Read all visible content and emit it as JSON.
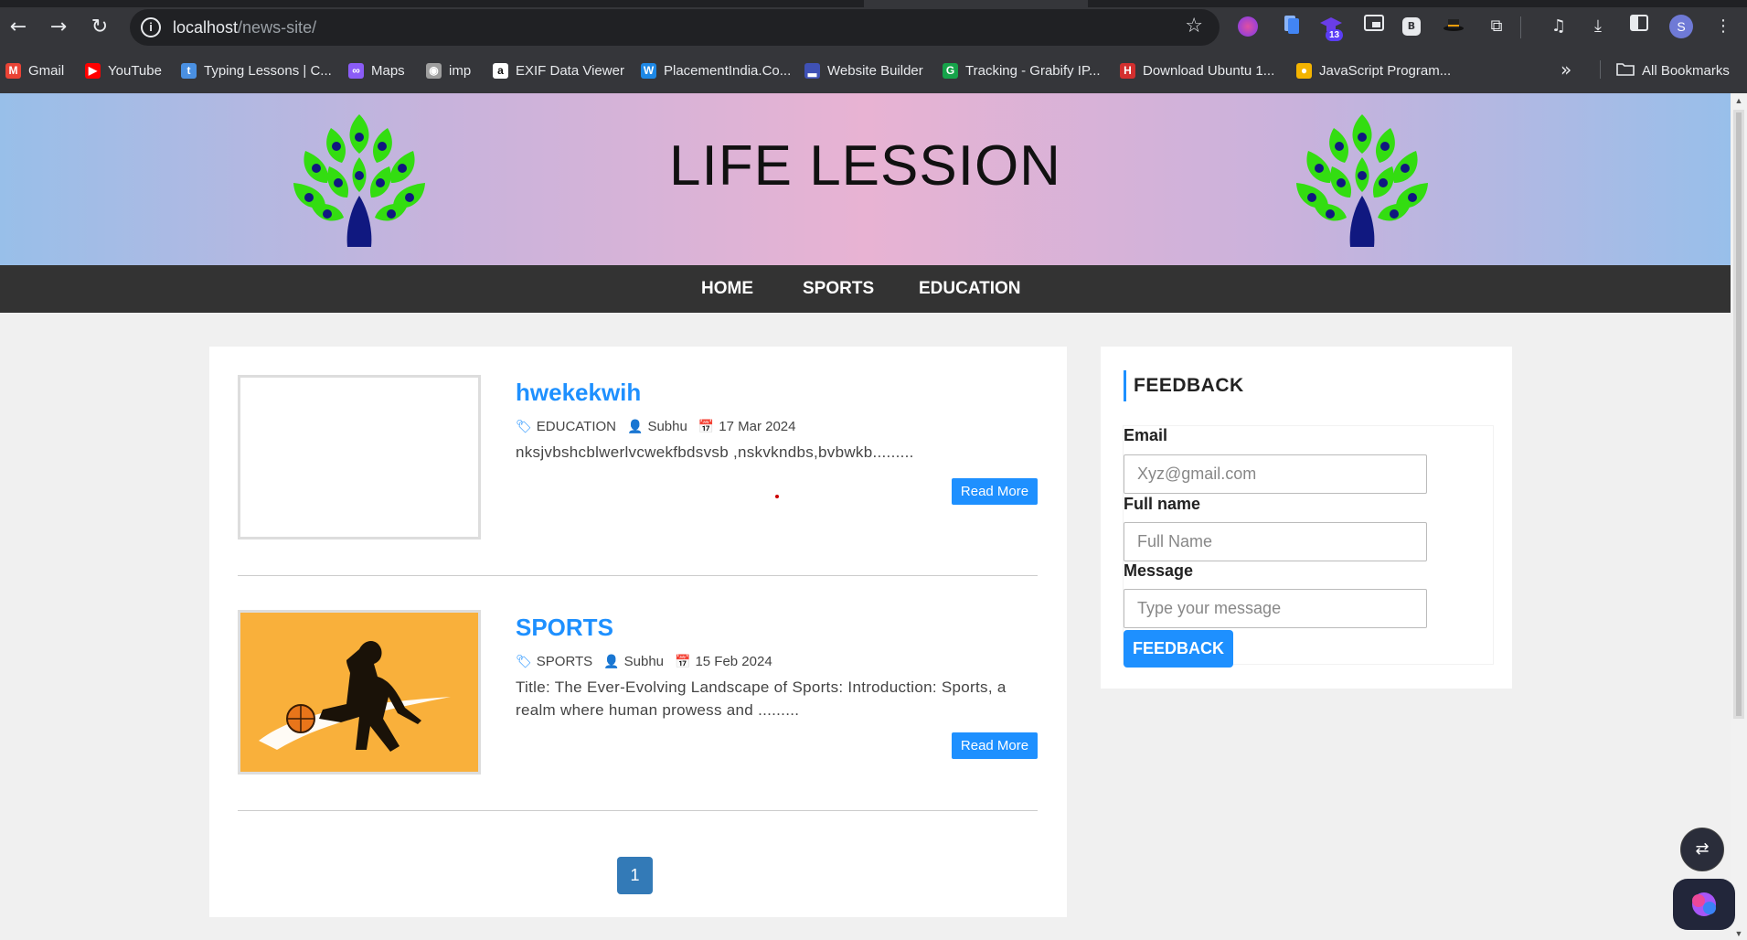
{
  "browser": {
    "url_host": "localhost",
    "url_path": "/news-site/",
    "avatar_letter": "S",
    "extension_badge": "13",
    "bookmarks": [
      {
        "label": "Gmail",
        "icon": "gmail-icon",
        "color": "#ea4335"
      },
      {
        "label": "YouTube",
        "icon": "youtube-icon",
        "color": "#ff0000"
      },
      {
        "label": "Typing Lessons | C...",
        "icon": "typing-icon",
        "color": "#4a90e2"
      },
      {
        "label": "Maps",
        "icon": "maps-icon",
        "color": "#8b5cf6"
      },
      {
        "label": "imp",
        "icon": "disc-icon",
        "color": "#9e9e9e"
      },
      {
        "label": "EXIF Data Viewer",
        "icon": "amazon-icon",
        "color": "#ffffff"
      },
      {
        "label": "PlacementIndia.Co...",
        "icon": "w-icon",
        "color": "#1e88e5"
      },
      {
        "label": "Website Builder",
        "icon": "builder-icon",
        "color": "#3f51b5"
      },
      {
        "label": "Tracking - Grabify IP...",
        "icon": "grabify-icon",
        "color": "#16a34a"
      },
      {
        "label": "Download Ubuntu 1...",
        "icon": "h-icon",
        "color": "#d32f2f"
      },
      {
        "label": "JavaScript Program...",
        "icon": "js-icon",
        "color": "#f4b400"
      }
    ],
    "all_bookmarks": "All Bookmarks"
  },
  "site": {
    "title": "LIFE LESSION",
    "menu": [
      "HOME",
      "SPORTS",
      "EDUCATION"
    ]
  },
  "posts": [
    {
      "title": "hwekekwih",
      "category": "EDUCATION",
      "author": "Subhu",
      "date": "17 Mar 2024",
      "excerpt": "nksjvbshcblwerlvcwekfbdsvsb ,nskvkndbs,bvbwkb.........",
      "read_more": "Read More",
      "has_image": false
    },
    {
      "title": "SPORTS",
      "category": "SPORTS",
      "author": "Subhu",
      "date": "15 Feb 2024",
      "excerpt": "Title: The Ever-Evolving Landscape of Sports: Introduction: Sports, a realm where human prowess and .........",
      "read_more": "Read More",
      "has_image": true
    }
  ],
  "pagination": {
    "current": "1"
  },
  "feedback": {
    "heading": "FEEDBACK",
    "email_label": "Email",
    "email_placeholder": "Xyz@gmail.com",
    "name_label": "Full name",
    "name_placeholder": "Full Name",
    "message_label": "Message",
    "message_placeholder": "Type your message",
    "submit": "FEEDBACK"
  },
  "colors": {
    "accent": "#1e90ff",
    "menu_bg": "#333333",
    "pagination": "#337ab7"
  }
}
